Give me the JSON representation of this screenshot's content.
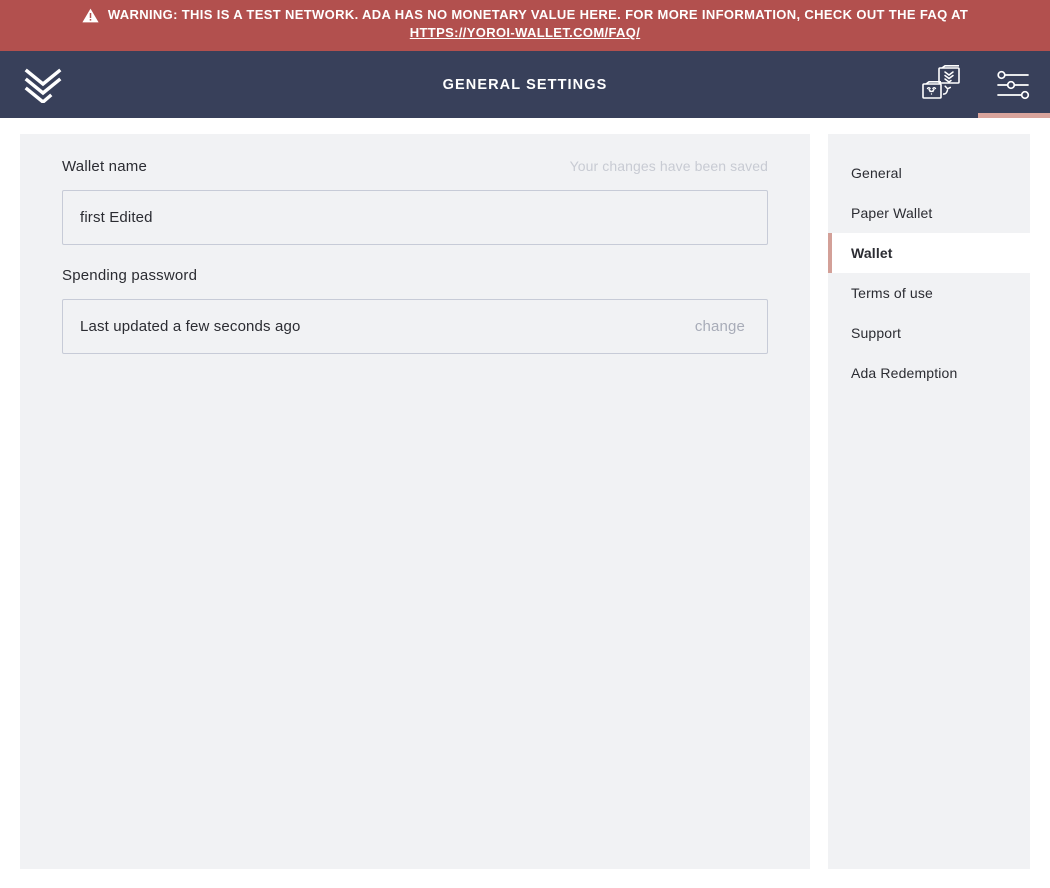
{
  "warning": {
    "icon": "warning-triangle-icon",
    "text": "WARNING: THIS IS A TEST NETWORK. ADA HAS NO MONETARY VALUE HERE. FOR MORE INFORMATION, CHECK OUT THE FAQ AT",
    "link_text": "HTTPS://YOROI-WALLET.COM/FAQ/",
    "background_color": "#b2504e",
    "text_color": "#ffffff"
  },
  "topbar": {
    "logo_icon": "yoroi-logo-icon",
    "title": "GENERAL SETTINGS",
    "background_color": "#38405a",
    "actions": [
      {
        "icon": "wallet-switch-icon",
        "name": "wallet-switch-button",
        "active": false
      },
      {
        "icon": "settings-sliders-icon",
        "name": "settings-button",
        "active": true
      }
    ],
    "active_indicator_color": "#d9a49c"
  },
  "settings": {
    "wallet_name": {
      "label": "Wallet name",
      "saved_note": "Your changes have been saved",
      "value": "first Edited",
      "placeholder": "Wallet name"
    },
    "spending_password": {
      "label": "Spending password",
      "status": "Last updated a few seconds ago",
      "change_label": "change"
    }
  },
  "menu": {
    "items": [
      {
        "label": "General",
        "active": false
      },
      {
        "label": "Paper Wallet",
        "active": false
      },
      {
        "label": "Wallet",
        "active": true
      },
      {
        "label": "Terms of use",
        "active": false
      },
      {
        "label": "Support",
        "active": false
      },
      {
        "label": "Ada Redemption",
        "active": false
      }
    ],
    "active_marker_color": "#d3a098"
  },
  "colors": {
    "panel": "#f1f2f4",
    "page": "#ffffff",
    "text": "#2b2c32",
    "muted": "#a8acb8"
  }
}
